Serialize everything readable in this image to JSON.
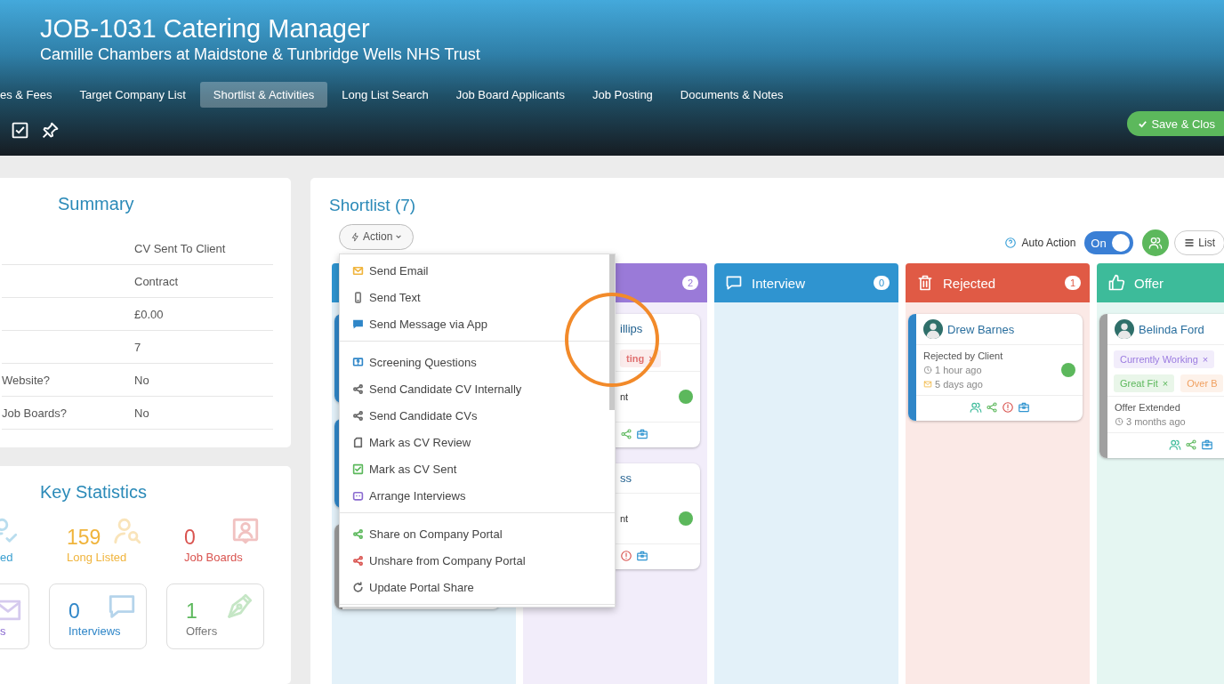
{
  "header": {
    "title": "JOB-1031 Catering Manager",
    "subtitle": "Camille Chambers at Maidstone & Tunbridge Wells NHS Trust",
    "tabs": [
      {
        "label": "es & Fees",
        "selected": false
      },
      {
        "label": "Target Company List",
        "selected": false
      },
      {
        "label": "Shortlist & Activities",
        "selected": true
      },
      {
        "label": "Long List Search",
        "selected": false
      },
      {
        "label": "Job Board Applicants",
        "selected": false
      },
      {
        "label": "Job Posting",
        "selected": false
      },
      {
        "label": "Documents & Notes",
        "selected": false
      }
    ],
    "save_button": "Save & Clos"
  },
  "summary": {
    "title": "Summary",
    "rows": [
      {
        "value": "CV Sent To Client"
      },
      {
        "value": "Contract"
      },
      {
        "value": "£0.00"
      },
      {
        "value": "7"
      },
      {
        "label": "Website?",
        "value": "No"
      },
      {
        "label": "Job Boards?",
        "value": "No"
      }
    ]
  },
  "key_statistics": {
    "title": "Key Statistics",
    "top": [
      {
        "kind": "shortlisted",
        "label": {
          "text": "ed",
          "color": "#3a9fd0"
        }
      },
      {
        "kind": "long-listed",
        "value": {
          "text": "159",
          "color": "#f0b43c"
        },
        "label": {
          "text": "Long Listed",
          "color": "#f0b43c"
        }
      },
      {
        "kind": "job-boards",
        "value": {
          "text": "0",
          "color": "#d9534f"
        },
        "label": {
          "text": "Job Boards",
          "color": "#d9534f"
        }
      }
    ],
    "boxed": [
      {
        "kind": "cv-sent",
        "label": {
          "text": "s",
          "color": "#8a6ad0"
        }
      },
      {
        "kind": "interviews",
        "value": {
          "text": "0",
          "color": "#2f86c8"
        },
        "label": {
          "text": "Interviews",
          "color": "#2f86c8"
        }
      },
      {
        "kind": "offers",
        "value": {
          "text": "1",
          "color": "#5cb85c"
        },
        "label": {
          "text": "Offers",
          "color": "#777777"
        }
      }
    ]
  },
  "shortlist": {
    "title": "Shortlist (7)",
    "action": {
      "label": "Action",
      "open": true
    },
    "menu_groups": [
      {
        "items": [
          {
            "kind": "email",
            "label": "Send Email",
            "color": "#f0b43c"
          },
          {
            "kind": "phone",
            "label": "Send Text",
            "color": "#777777"
          },
          {
            "kind": "message",
            "label": "Send Message via App",
            "color": "#2f86c8"
          }
        ]
      },
      {
        "items": [
          {
            "kind": "screening",
            "label": "Screening Questions",
            "color": "#2f86c8"
          },
          {
            "kind": "share",
            "label": "Send Candidate CV Internally",
            "color": "#666666"
          },
          {
            "kind": "share",
            "label": "Send Candidate CVs",
            "color": "#666666"
          },
          {
            "kind": "document",
            "label": "Mark as CV Review",
            "color": "#666666"
          },
          {
            "kind": "check",
            "label": "Mark as CV Sent",
            "color": "#5cb85c"
          },
          {
            "kind": "calendar",
            "label": "Arrange Interviews",
            "color": "#8a6ad0"
          }
        ]
      },
      {
        "items": [
          {
            "kind": "share",
            "label": "Share on Company Portal",
            "color": "#5cb85c"
          },
          {
            "kind": "share",
            "label": "Unshare from Company Portal",
            "color": "#d9534f"
          },
          {
            "kind": "refresh",
            "label": "Update Portal Share",
            "color": "#666666"
          }
        ]
      }
    ],
    "auto_action": {
      "label": "Auto Action",
      "toggle": "On",
      "on": true
    },
    "view_button": "List",
    "columns": [
      {
        "kind": "hidden",
        "color": "#2f94d0",
        "cards": [
          {
            "kind": "hidden",
            "color": "#2f86c8"
          },
          {
            "kind": "hidden",
            "color": "#2f86c8"
          },
          {
            "kind": "hidden",
            "color": "#9a9a9a"
          }
        ]
      },
      {
        "kind": "hidden",
        "color": "#9a7ad8",
        "count": "2",
        "cards": [
          {
            "kind": "clipped",
            "name": "illips",
            "tags": [
              {
                "label": "ting",
                "remove": "×",
                "color": "#e07070"
              }
            ],
            "status": "nt",
            "status_dot": {
              "color": "#5cb85c"
            },
            "actions": [
              {
                "kind": "share"
              },
              {
                "kind": "briefcase"
              }
            ]
          },
          {
            "kind": "clipped",
            "name": "ss",
            "status": "nt",
            "status_dot": {
              "color": "#5cb85c"
            },
            "actions": [
              {
                "kind": "alert"
              },
              {
                "kind": "briefcase"
              }
            ]
          }
        ]
      },
      {
        "kind": "interview",
        "title": "Interview",
        "color": "#2f94d0",
        "count": "0"
      },
      {
        "kind": "rejected",
        "title": "Rejected",
        "color": "#e05a45",
        "count": "1",
        "cards": [
          {
            "kind": "full",
            "color": "#2f86c8",
            "name": "Drew Barnes",
            "status": "Rejected by Client",
            "time": "1 hour ago",
            "email_time": "5 days ago",
            "status_dot": {
              "color": "#5cb85c"
            },
            "actions": [
              {
                "kind": "people"
              },
              {
                "kind": "share"
              },
              {
                "kind": "alert"
              },
              {
                "kind": "briefcase"
              }
            ]
          }
        ]
      },
      {
        "kind": "offer",
        "title": "Offer",
        "color": "#3dbb9a",
        "cards": [
          {
            "kind": "full",
            "color": "#a0a0a0",
            "name": "Belinda Ford",
            "tags": [
              {
                "label": "Currently Working",
                "remove": "×",
                "color": "#9b7be0"
              },
              {
                "label": "Great Fit",
                "remove": "×",
                "color": "#5cb85c"
              },
              {
                "label": "Over B",
                "color": "#f0a060"
              }
            ],
            "status": "Offer Extended",
            "time": "3 months ago",
            "actions": [
              {
                "kind": "people"
              },
              {
                "kind": "share"
              },
              {
                "kind": "briefcase"
              }
            ]
          }
        ]
      }
    ]
  }
}
